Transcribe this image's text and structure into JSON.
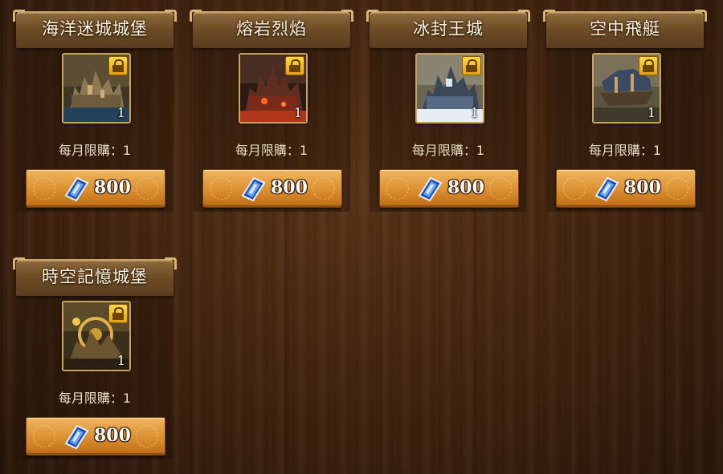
{
  "items": [
    {
      "title": "海洋迷城城堡",
      "quantity": "1",
      "limit": "每月限購：1",
      "price": "800",
      "theme": "ocean"
    },
    {
      "title": "熔岩烈焰",
      "quantity": "1",
      "limit": "每月限購：1",
      "price": "800",
      "theme": "lava"
    },
    {
      "title": "冰封王城",
      "quantity": "1",
      "limit": "每月限購：1",
      "price": "800",
      "theme": "ice"
    },
    {
      "title": "空中飛艇",
      "quantity": "1",
      "limit": "每月限購：1",
      "price": "800",
      "theme": "airship"
    },
    {
      "title": "時空記憶城堡",
      "quantity": "1",
      "limit": "每月限購：1",
      "price": "800",
      "theme": "clockwork"
    }
  ],
  "icons": {
    "currency": "blue-ticket-gem-icon",
    "badge": "lock-badge-icon"
  },
  "colors": {
    "button": "#e09a3c",
    "badge": "#ffd84a",
    "title_text": "#fff6e2"
  }
}
